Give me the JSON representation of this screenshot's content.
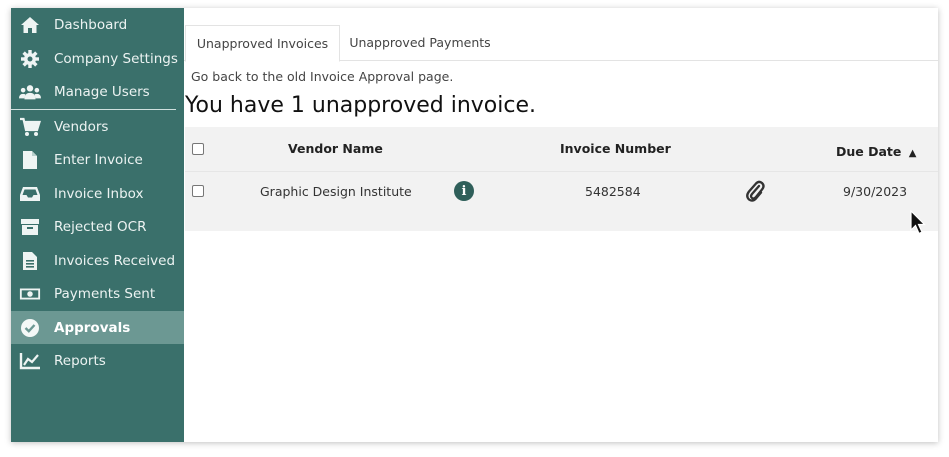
{
  "sidebar": {
    "items": [
      {
        "label": "Dashboard",
        "icon": "home-icon",
        "active": false
      },
      {
        "label": "Company Settings",
        "icon": "gear-icon",
        "active": false
      },
      {
        "label": "Manage Users",
        "icon": "users-icon",
        "active": false
      },
      {
        "label": "Vendors",
        "icon": "cart-icon",
        "active": false
      },
      {
        "label": "Enter Invoice",
        "icon": "file-icon",
        "active": false
      },
      {
        "label": "Invoice Inbox",
        "icon": "inbox-icon",
        "active": false
      },
      {
        "label": "Rejected OCR",
        "icon": "archive-icon",
        "active": false
      },
      {
        "label": "Invoices Received",
        "icon": "document-icon",
        "active": false
      },
      {
        "label": "Payments Sent",
        "icon": "money-icon",
        "active": false
      },
      {
        "label": "Approvals",
        "icon": "check-circle-icon",
        "active": true
      },
      {
        "label": "Reports",
        "icon": "chart-icon",
        "active": false
      }
    ]
  },
  "tabs": [
    {
      "label": "Unapproved Invoices",
      "active": true
    },
    {
      "label": "Unapproved Payments",
      "active": false
    }
  ],
  "back_link": "Go back to the old Invoice Approval page.",
  "headline": "You have 1 unapproved invoice.",
  "table": {
    "headers": {
      "vendor": "Vendor Name",
      "invoice_number": "Invoice Number",
      "due_date": "Due Date",
      "sort_indicator": "▲"
    },
    "rows": [
      {
        "vendor": "Graphic Design Institute",
        "invoice_number": "5482584",
        "due_date": "9/30/2023"
      }
    ]
  },
  "colors": {
    "sidebar_bg": "#3a706b",
    "sidebar_active": "#6c9893",
    "info_icon": "#2f5f5a"
  }
}
